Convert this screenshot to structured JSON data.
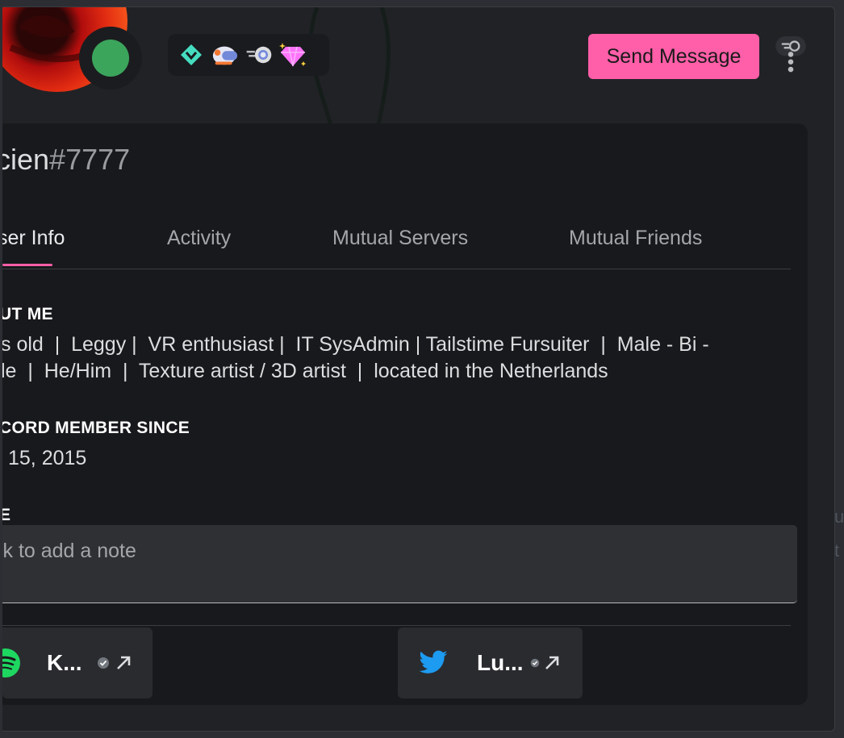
{
  "window": {
    "edge_text": [
      "uh",
      "t"
    ]
  },
  "profile": {
    "username": "cien",
    "discriminator": "#7777",
    "status": "online"
  },
  "badges": [
    {
      "icon": "hypesquad-balance-icon",
      "color": "#45ddc0"
    },
    {
      "icon": "early-supporter-icon",
      "color": "#7289da"
    },
    {
      "icon": "server-boost-icon",
      "color": "#b9bbbe"
    },
    {
      "icon": "nitro-gem-icon",
      "color": "#ff73fa"
    }
  ],
  "actions": {
    "send_message": "Send Message"
  },
  "tabs": [
    {
      "label": "ser Info",
      "active": true
    },
    {
      "label": "Activity",
      "active": false
    },
    {
      "label": "Mutual Servers",
      "active": false
    },
    {
      "label": "Mutual Friends",
      "active": false
    }
  ],
  "about": {
    "heading": "UT ME",
    "line1": "s old  |  Leggy |  VR enthusiast |  IT SysAdmin | Tailstime Fursuiter  |  Male - Bi -",
    "line2": "le  |  He/Him  |  Texture artist / 3D artist  |  located in the Netherlands"
  },
  "member_since": {
    "heading": "CORD MEMBER SINCE",
    "value": "15, 2015"
  },
  "note": {
    "heading": "E",
    "placeholder": "ck to add a note"
  },
  "connections": [
    {
      "service": "spotify-icon",
      "name": "K...",
      "verified": true
    },
    {
      "service": "twitter-icon",
      "name": "Lu...",
      "verified": true
    }
  ],
  "colors": {
    "accent": "#ff5ea8",
    "online": "#3ba55c",
    "spotify": "#1ed760",
    "twitter": "#1d9bf0"
  }
}
